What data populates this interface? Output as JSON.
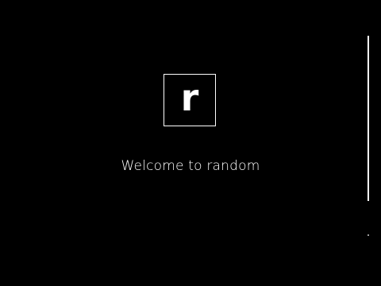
{
  "logo": {
    "letter": "r"
  },
  "welcome": {
    "text": "Welcome to random"
  },
  "colors": {
    "background": "#000000",
    "foreground": "#ffffff"
  }
}
